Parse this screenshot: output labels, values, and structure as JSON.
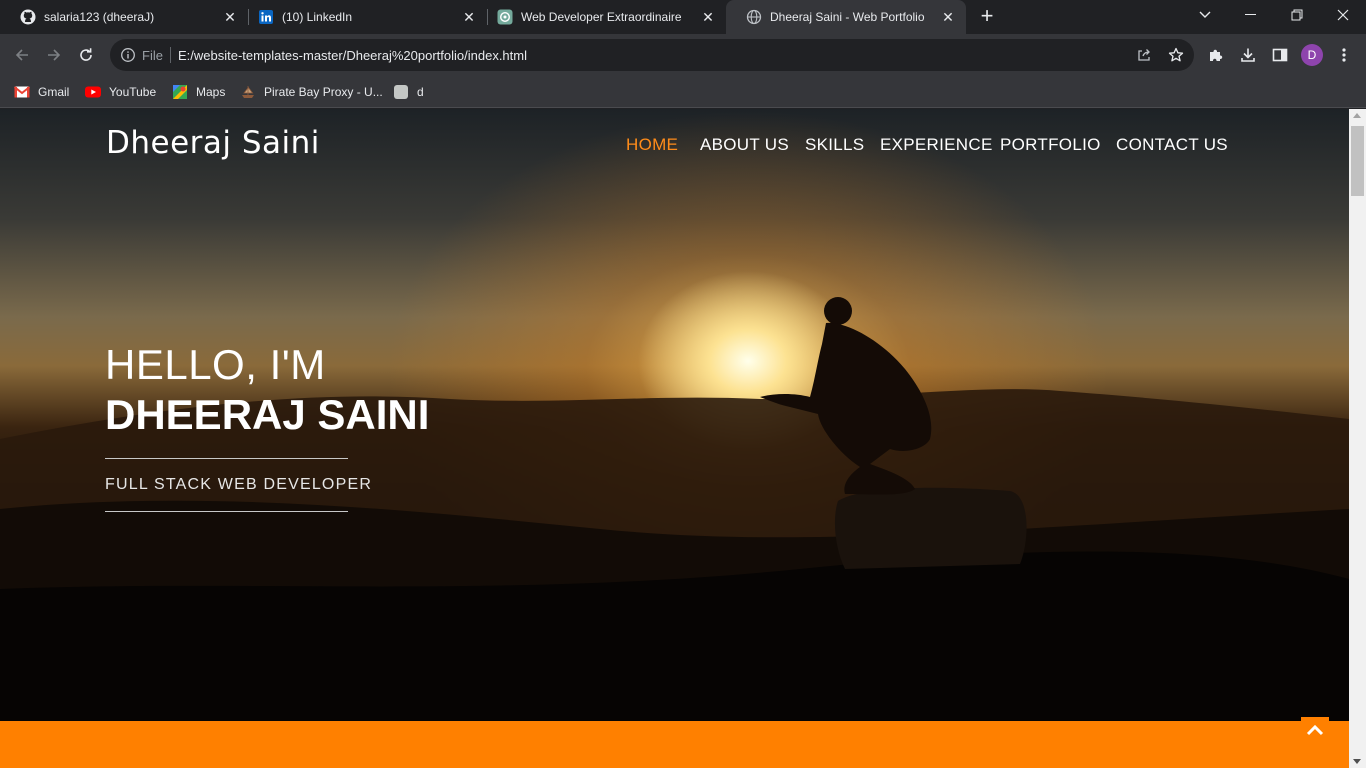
{
  "tabs": [
    {
      "title": "salaria123 (dheeraJ)",
      "icon": "github-icon"
    },
    {
      "title": "(10) LinkedIn",
      "icon": "linkedin-icon"
    },
    {
      "title": "Web Developer Extraordinaire",
      "icon": "chatgpt-icon"
    },
    {
      "title": "Dheeraj Saini - Web Portfolio",
      "icon": "globe-icon",
      "active": true
    }
  ],
  "omnibox": {
    "scheme_label": "File",
    "url": "E:/website-templates-master/Dheeraj%20portfolio/index.html"
  },
  "profile": {
    "initial": "D"
  },
  "bookmarks": [
    {
      "label": "Gmail",
      "icon": "gmail-icon"
    },
    {
      "label": "YouTube",
      "icon": "youtube-icon"
    },
    {
      "label": "Maps",
      "icon": "maps-icon"
    },
    {
      "label": "Pirate Bay Proxy - U...",
      "icon": "ship-icon"
    },
    {
      "label": "d",
      "icon": "blank-page-icon"
    }
  ],
  "site": {
    "brand": "Dheeraj Saini",
    "nav": [
      "HOME",
      "ABOUT US",
      "SKILLS",
      "EXPERIENCE",
      "PORTFOLIO",
      "CONTACT US"
    ],
    "active_nav": "HOME",
    "hero": {
      "greeting": "HELLO, I'M",
      "name": "DHEERAJ SAINI",
      "role": "FULL STACK WEB DEVELOPER"
    },
    "accent_color": "#ff8000"
  }
}
